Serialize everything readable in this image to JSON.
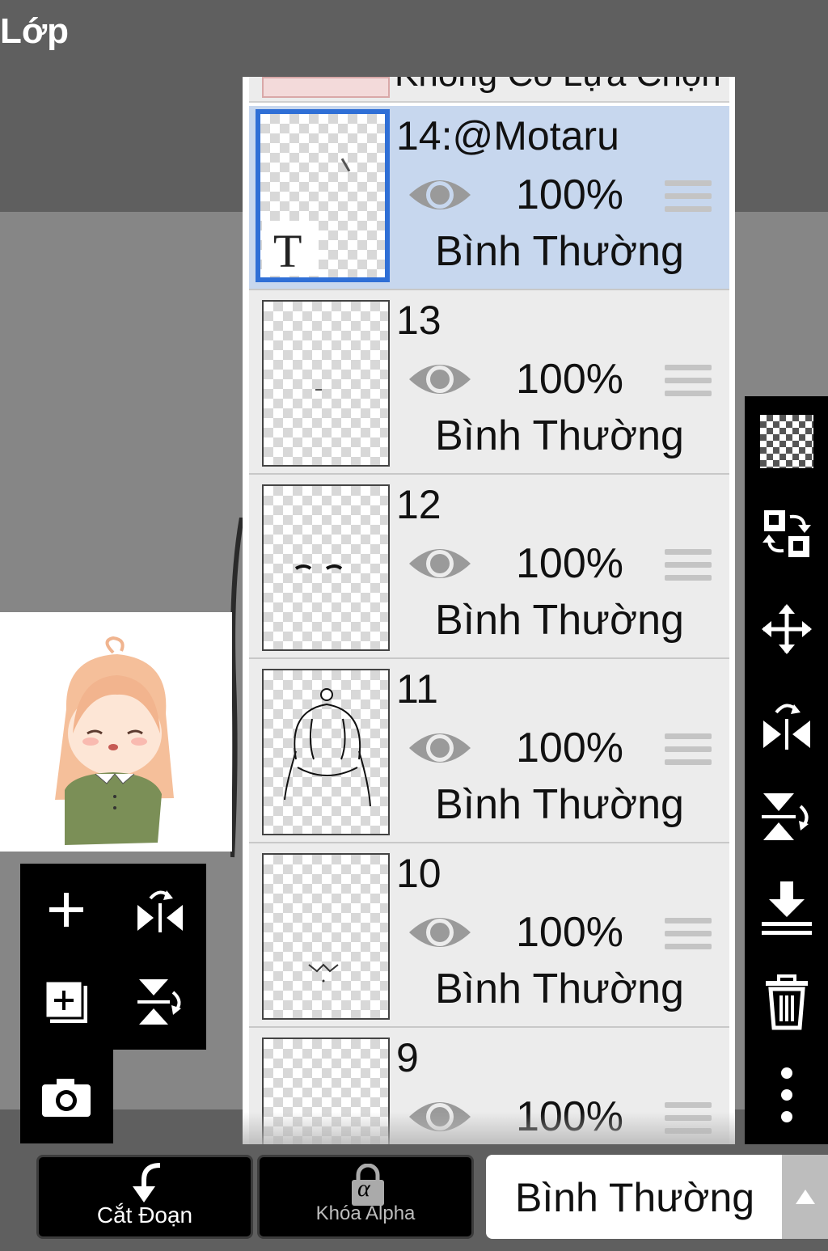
{
  "header": {
    "title": "Lớp"
  },
  "layers_panel": {
    "partial_top_label": "Không Có Lựa Chọn",
    "layers": [
      {
        "name": "14:@Motaru",
        "opacity": "100%",
        "blend": "Bình Thường",
        "selected": true,
        "is_text": true,
        "text_marker": "T"
      },
      {
        "name": "13",
        "opacity": "100%",
        "blend": "Bình Thường",
        "selected": false
      },
      {
        "name": "12",
        "opacity": "100%",
        "blend": "Bình Thường",
        "selected": false
      },
      {
        "name": "11",
        "opacity": "100%",
        "blend": "Bình Thường",
        "selected": false
      },
      {
        "name": "10",
        "opacity": "100%",
        "blend": "Bình Thường",
        "selected": false
      },
      {
        "name": "9",
        "opacity": "100%",
        "blend": "",
        "selected": false
      }
    ]
  },
  "left_toolbar": {
    "icons": [
      "add-layer-icon",
      "flip-horizontal-icon",
      "duplicate-layer-icon",
      "flip-vertical-icon",
      "camera-icon"
    ]
  },
  "right_toolbar": {
    "icons": [
      "transparency-icon",
      "swap-layers-icon",
      "move-icon",
      "flip-horizontal-icon",
      "flip-vertical-icon",
      "merge-down-icon",
      "trash-icon",
      "more-icon"
    ]
  },
  "bottom_bar": {
    "clip_label": "Cắt Đoạn",
    "alpha_lock_label": "Khóa Alpha",
    "alpha_symbol": "α",
    "blend_mode_value": "Bình Thường"
  },
  "colors": {
    "selection_blue": "#2f6fd6",
    "selected_row": "#c7d7ee",
    "row_bg": "#ececec",
    "toolbar_bg": "#000000",
    "background": "#5f5f5f"
  }
}
